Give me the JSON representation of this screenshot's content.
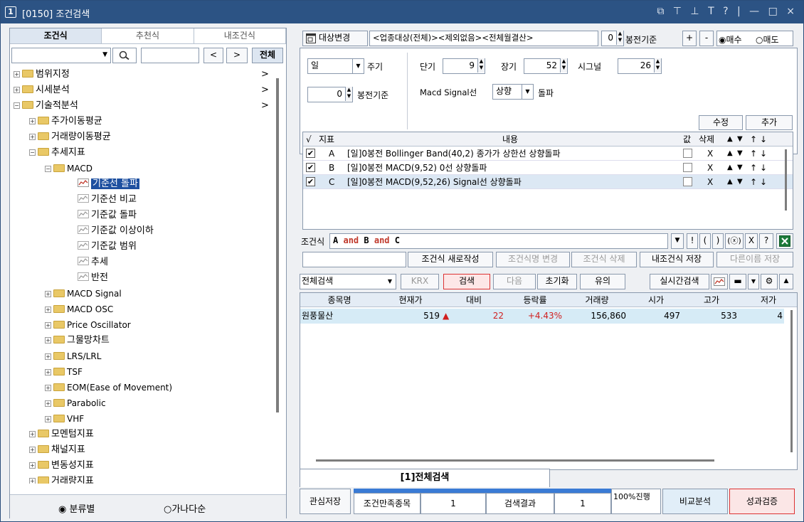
{
  "window": {
    "num": "1",
    "title": "[0150] 조건검색",
    "icons": "⧉ ⊤ ⊥ T ? | — □ ×"
  },
  "left": {
    "tabs": [
      "조건식",
      "추천식",
      "내조건식"
    ],
    "search": {
      "prev": "<",
      "next": ">",
      "all": "전체"
    },
    "tree": [
      {
        "label": "범위지정",
        "arrow": ">"
      },
      {
        "label": "시세분석",
        "arrow": ">"
      },
      {
        "label": "기술적분석",
        "arrow": ">"
      },
      {
        "label": "주가이동평균"
      },
      {
        "label": "거래량이동평균"
      },
      {
        "label": "추세지표"
      },
      {
        "label": "MACD"
      },
      {
        "label": "기준선 돌파"
      },
      {
        "label": "기준선 비교"
      },
      {
        "label": "기준값 돌파"
      },
      {
        "label": "기준값 이상이하"
      },
      {
        "label": "기준값 범위"
      },
      {
        "label": "추세"
      },
      {
        "label": "반전"
      },
      {
        "label": "MACD Signal"
      },
      {
        "label": "MACD OSC"
      },
      {
        "label": "Price Oscillator"
      },
      {
        "label": "그물망차트"
      },
      {
        "label": "LRS/LRL"
      },
      {
        "label": "TSF"
      },
      {
        "label": "EOM(Ease of Movement)"
      },
      {
        "label": "Parabolic"
      },
      {
        "label": "VHF"
      },
      {
        "label": "모멘텀지표"
      },
      {
        "label": "채널지표"
      },
      {
        "label": "변동성지표"
      },
      {
        "label": "거래량지표"
      }
    ],
    "radio": {
      "opt1": "분류별",
      "opt2": "가나다순"
    }
  },
  "right": {
    "top": {
      "target_btn": "대상변경",
      "target_text": "<업종대상(전체)><제외없음><전체월결산>",
      "bong_val": "0",
      "bong_label": "봉전기준",
      "plus": "+",
      "minus": "-",
      "buy": "매수",
      "sell": "매도"
    },
    "settings": {
      "period_val": "일",
      "period_label": "주기",
      "bong_val": "0",
      "bong_label": "봉전기준",
      "short_label": "단기",
      "short_val": "9",
      "long_label": "장기",
      "long_val": "52",
      "signal_label": "시그널",
      "signal_val": "26",
      "macd_label": "Macd Signal선",
      "dir_val": "상향",
      "cross_label": "돌파",
      "edit": "수정",
      "add": "추가"
    },
    "grid": {
      "headers": {
        "check": "√",
        "ind": "지표",
        "content": "내용",
        "val": "값",
        "del": "삭제",
        "up": "▲",
        "down": "▼",
        "top": "↑",
        "bottom": "↓"
      },
      "rows": [
        {
          "ind": "A",
          "content": "[일]0봉전 Bollinger Band(40,2) 종가가 상한선 상향돌파",
          "del": "X"
        },
        {
          "ind": "B",
          "content": "[일]0봉전 MACD(9,52) 0선 상향돌파",
          "del": "X"
        },
        {
          "ind": "C",
          "content": "[일]0봉전 MACD(9,52,26) Signal선 상향돌파",
          "del": "X"
        }
      ]
    },
    "formula": {
      "label": "조건식",
      "a": "A",
      "and1": "and",
      "b": "B",
      "and2": "and",
      "c": "C",
      "ops": [
        "!",
        "(",
        ")",
        "(ⓧ)",
        "X",
        "?"
      ]
    },
    "actions": {
      "new": "조건식 새로작성",
      "rename": "조건식명 변경",
      "delete": "조건식 삭제",
      "save": "내조건식 저장",
      "saveas": "다른이름 저장"
    },
    "search_bar": {
      "scope": "전체검색",
      "krx": "KRX",
      "search": "검색",
      "next": "다음",
      "reset": "초기화",
      "note": "유의",
      "realtime": "실시간검색"
    },
    "results": {
      "headers": [
        "종목명",
        "현재가",
        "대비",
        "등락률",
        "거래량",
        "시가",
        "고가",
        "저가"
      ],
      "rows": [
        {
          "name": "원풍물산",
          "price": "519",
          "diff": "22",
          "rate": "+4.43%",
          "volume": "156,860",
          "open": "497",
          "high": "533",
          "low": "4"
        }
      ]
    },
    "tab": "[1]전체검색",
    "status": {
      "watch": "관심저장",
      "cond_label": "조건만족종목",
      "cond_val": "1",
      "res_label": "검색결과",
      "res_val": "1",
      "progress": "100%진행",
      "compare": "비교분석",
      "verify": "성과검증"
    }
  }
}
